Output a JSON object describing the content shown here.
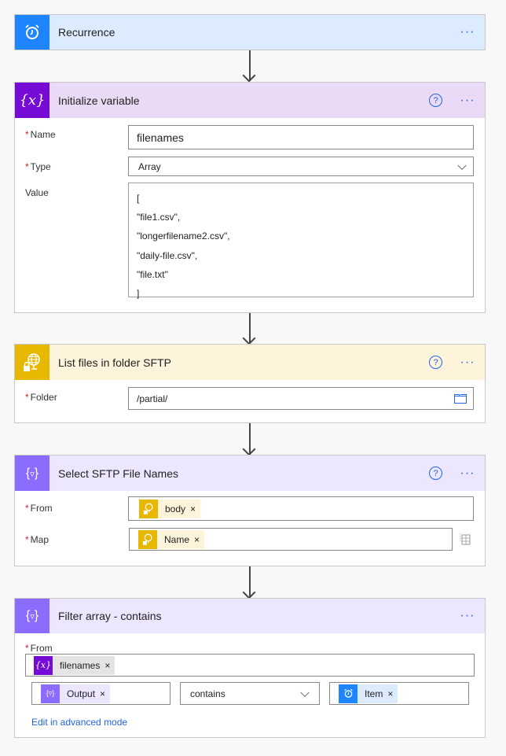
{
  "colors": {
    "recurrence_icon_bg": "#1f85ff",
    "recurrence_header_bg": "#dcebfe",
    "variable_icon_bg": "#770bd6",
    "variable_header_bg": "#eadaf6",
    "sftp_icon_bg": "#e8b700",
    "sftp_header_bg": "#fdf4db",
    "data_op_icon_bg": "#8c6cff",
    "data_op_header_bg": "#ece7fe",
    "link": "#2266e3",
    "required": "#c4262e"
  },
  "cards": {
    "recurrence": {
      "title": "Recurrence",
      "icon": "alarm-clock-icon",
      "more": "···"
    },
    "init_variable": {
      "title": "Initialize variable",
      "icon": "variable-icon",
      "help": "?",
      "more": "···",
      "name_label": "Name",
      "name_value": "filenames",
      "type_label": "Type",
      "type_value": "Array",
      "value_label": "Value",
      "value_lines": [
        "[",
        "\"file1.csv\",",
        "\"longerfilename2.csv\",",
        "\"daily-file.csv\",",
        "\"file.txt\"",
        "]"
      ]
    },
    "list_files": {
      "title": "List files in folder SFTP",
      "icon": "sftp-globe-lock-icon",
      "help": "?",
      "more": "···",
      "folder_label": "Folder",
      "folder_value": "/partial/"
    },
    "select": {
      "title": "Select SFTP File Names",
      "icon": "data-operation-icon",
      "help": "?",
      "more": "···",
      "from_label": "From",
      "from_token": "body",
      "map_label": "Map",
      "map_token": "Name"
    },
    "filter": {
      "title": "Filter array - contains",
      "icon": "data-operation-icon",
      "more": "···",
      "from_label": "From",
      "from_token": "filenames",
      "left_token": "Output",
      "operator": "contains",
      "right_token": "Item",
      "advanced_link": "Edit in advanced mode"
    }
  },
  "required_marker": "*",
  "token_remove": "×"
}
